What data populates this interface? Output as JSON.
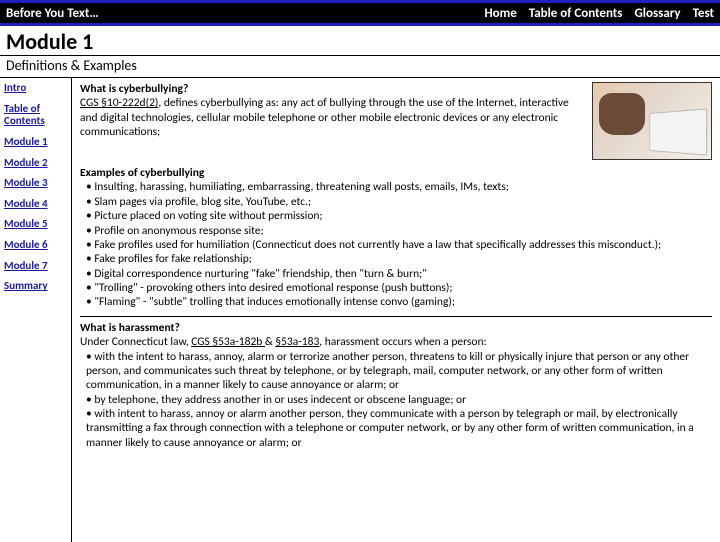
{
  "topbar": {
    "title": "Before You Text…",
    "links": [
      "Home",
      "Table of Contents",
      "Glossary",
      "Test"
    ]
  },
  "module_title": "Module 1",
  "subtitle": "Definitions & Examples",
  "sidebar": {
    "items": [
      {
        "label": "Intro"
      },
      {
        "label": "Table of Contents"
      },
      {
        "label": "Module 1"
      },
      {
        "label": "Module 2"
      },
      {
        "label": "Module 3"
      },
      {
        "label": "Module 4"
      },
      {
        "label": "Module 5"
      },
      {
        "label": "Module 6"
      },
      {
        "label": "Module 7"
      },
      {
        "label": "Summary"
      }
    ]
  },
  "definition": {
    "heading": "What is cyberbullying?",
    "citation": "CGS §10-222d(2)",
    "body": ", defines cyberbullying as: any act of bullying through the use of the Internet, interactive and digital technologies, cellular mobile telephone or other mobile electronic devices or any electronic communications;",
    "image_alt": "child-at-laptop-photo"
  },
  "examples": {
    "heading": "Examples of cyberbullying",
    "items": [
      "Insulting, harassing, humiliating, embarrassing, threatening wall posts, emails, IMs, texts;",
      "Slam pages via profile, blog site, YouTube, etc.;",
      "Picture placed on voting site without permission;",
      "Profile on anonymous response site;",
      "Fake profiles used for humiliation (Connecticut does not currently have a law that specifically addresses this misconduct.);",
      "Fake profiles for fake relationship;",
      "Digital correspondence nurturing \"fake\" friendship, then \"turn & burn;\"",
      "\"Trolling\" - provoking others into desired emotional response (push buttons);",
      "\"Flaming\" - \"subtle\" trolling that induces emotionally intense convo (gaming);"
    ]
  },
  "harassment": {
    "heading": "What is harassment?",
    "lead_pre": "Under Connecticut law, ",
    "cite1": "CGS §53a-182b ",
    "amp": "& ",
    "cite2": "§53a-183",
    "lead_post": ", harassment occurs when a person:",
    "items": [
      "with the intent to harass, annoy, alarm or terrorize another person, threatens to kill or physically injure that person or any other person, and communicates such threat by telephone, or by telegraph, mail, computer network, or any other form of written communication, in a manner likely to cause annoyance or alarm; or",
      "by telephone, they address another in or uses indecent or obscene language; or",
      "with intent to harass, annoy or alarm another person, they communicate with a person by telegraph or mail, by electronically transmitting a fax through connection with a telephone or computer network, or by any other form of written communication, in a manner likely to cause annoyance or alarm; or"
    ]
  }
}
